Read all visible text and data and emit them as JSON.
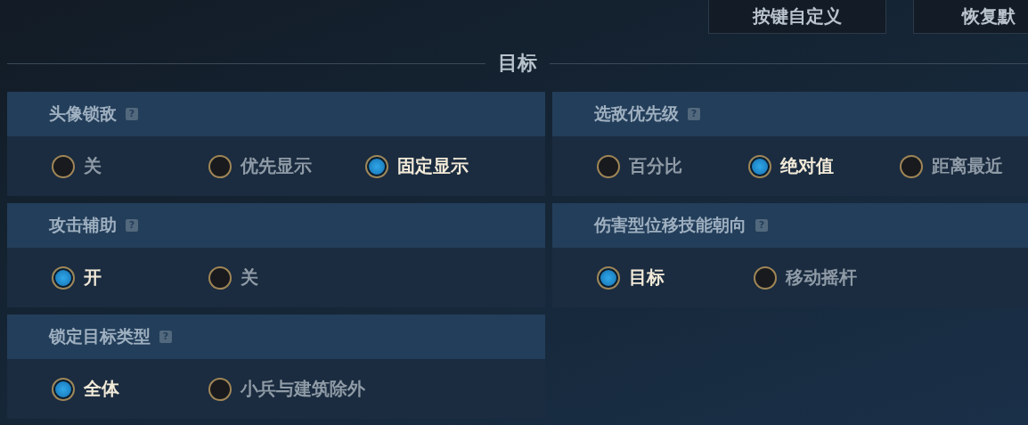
{
  "top_buttons": [
    {
      "label": "按键自定义"
    },
    {
      "label": "恢复默"
    }
  ],
  "section_title": "目标",
  "panels": [
    {
      "title": "头像锁敌",
      "help": "?",
      "options": [
        {
          "label": "关",
          "selected": false
        },
        {
          "label": "优先显示",
          "selected": false
        },
        {
          "label": "固定显示",
          "selected": true
        }
      ]
    },
    {
      "title": "选敌优先级",
      "help": "?",
      "options": [
        {
          "label": "百分比",
          "selected": false
        },
        {
          "label": "绝对值",
          "selected": true
        },
        {
          "label": "距离最近",
          "selected": false
        }
      ]
    },
    {
      "title": "攻击辅助",
      "help": "?",
      "options": [
        {
          "label": "开",
          "selected": true
        },
        {
          "label": "关",
          "selected": false
        }
      ]
    },
    {
      "title": "伤害型位移技能朝向",
      "help": "?",
      "options": [
        {
          "label": "目标",
          "selected": true
        },
        {
          "label": "移动摇杆",
          "selected": false
        }
      ]
    },
    {
      "title": "锁定目标类型",
      "help": "?",
      "options": [
        {
          "label": "全体",
          "selected": true
        },
        {
          "label": "小兵与建筑除外",
          "selected": false
        }
      ]
    }
  ]
}
